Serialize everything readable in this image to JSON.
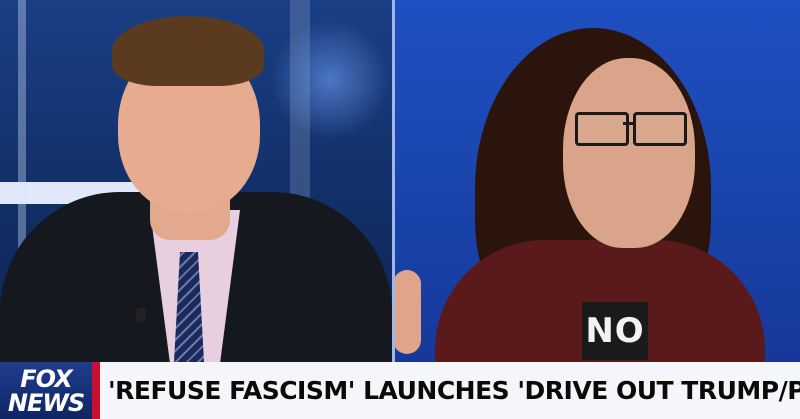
{
  "broadcast": {
    "network_logo_top": "FOX",
    "network_logo_bottom": "NEWS",
    "headline": "'REFUSE FASCISM' LAUNCHES 'DRIVE OUT TRUMP/PENCE' TOUR"
  },
  "guest": {
    "shirt_text": "NO"
  },
  "colors": {
    "set_left": "#13326d",
    "set_right": "#1a45ad",
    "lower_third_bg": "#f4f6fa",
    "logo_bg": "#0f2563",
    "accent_red": "#c8102e"
  }
}
